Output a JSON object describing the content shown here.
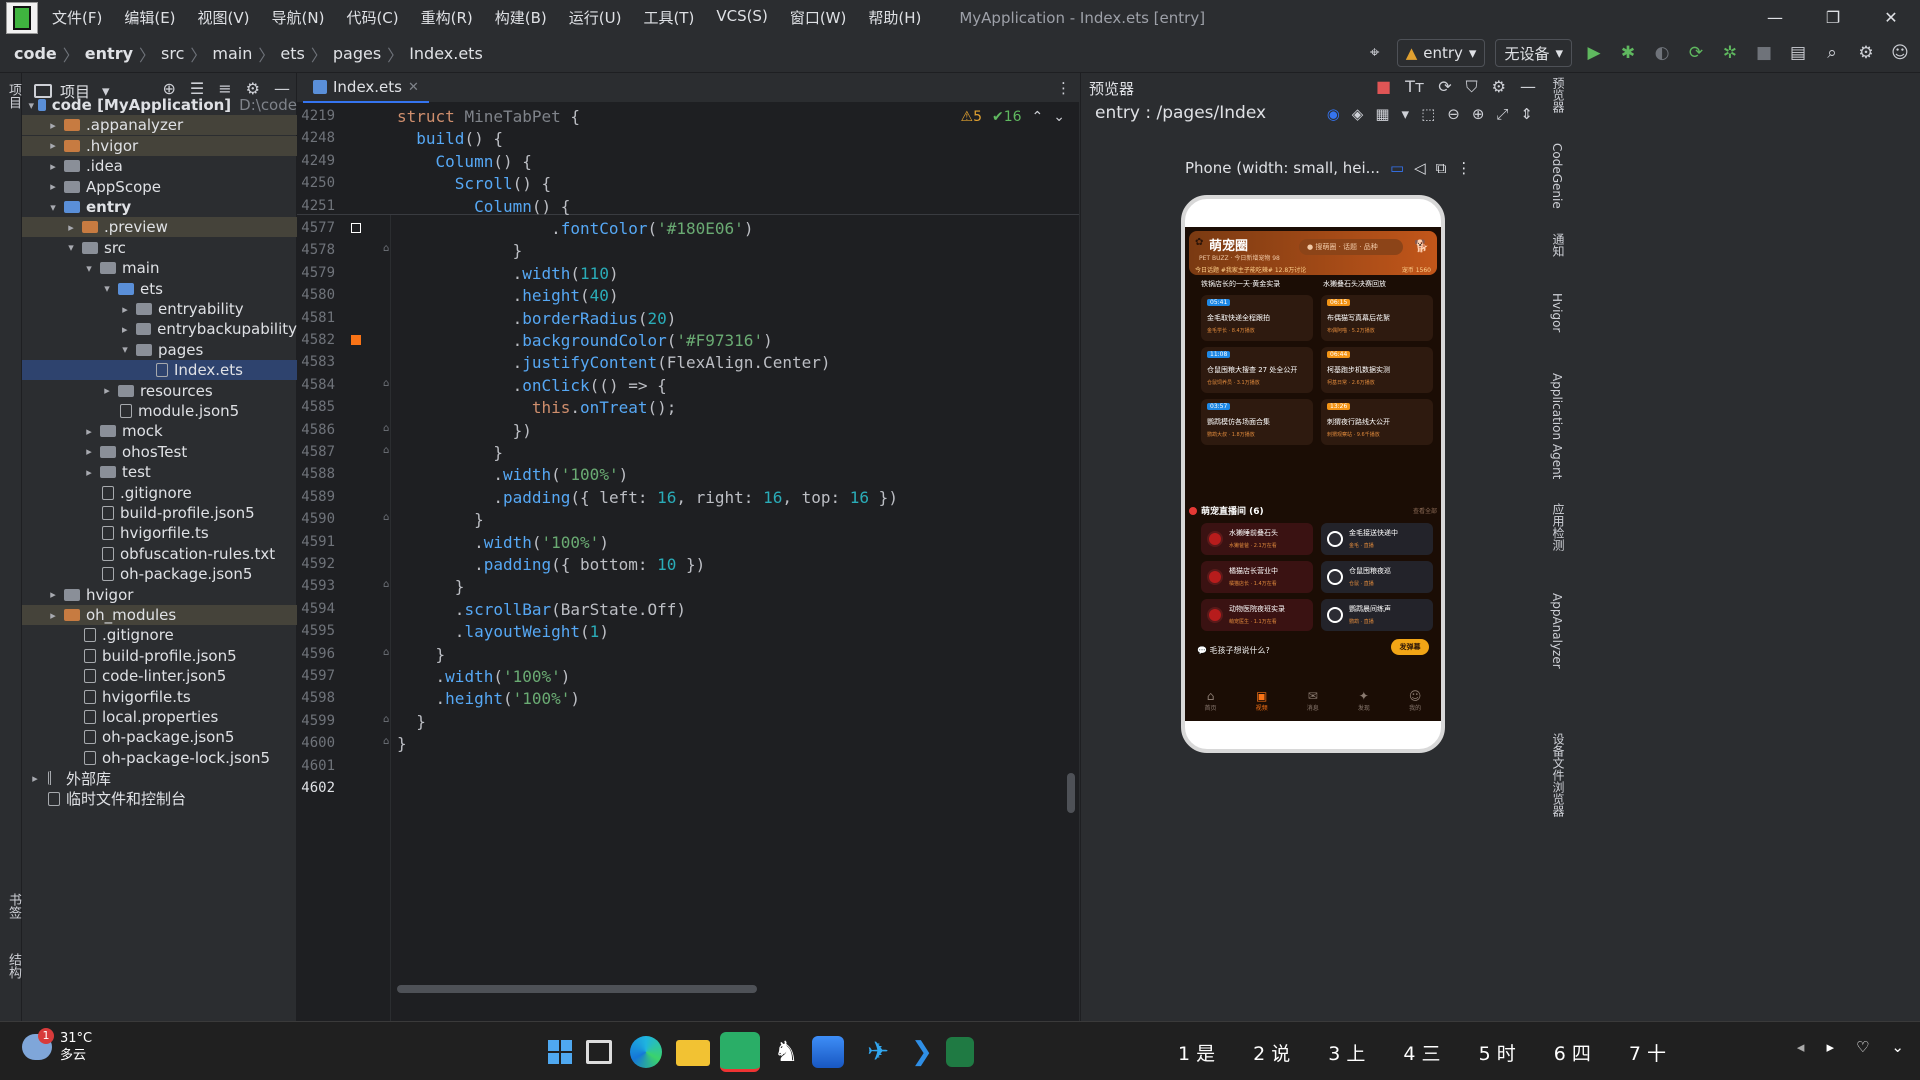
{
  "titlebar": {
    "menus": [
      "文件(F)",
      "编辑(E)",
      "视图(V)",
      "导航(N)",
      "代码(C)",
      "重构(R)",
      "构建(B)",
      "运行(U)",
      "工具(T)",
      "VCS(S)",
      "窗口(W)",
      "帮助(H)"
    ],
    "title": "MyApplication - Index.ets [entry]",
    "minimize": "—",
    "restore": "❐",
    "close": "✕"
  },
  "navbar": {
    "crumbs": [
      "code",
      "entry",
      "src",
      "main",
      "ets",
      "pages",
      "Index.ets"
    ],
    "run_config": "entry",
    "device": "无设备"
  },
  "left_strip": {
    "project": "项目",
    "bookmarks": "书签",
    "structure": "结构"
  },
  "project": {
    "title": "项目",
    "tree": [
      {
        "label": "code [MyApplication]",
        "hint": "D:\\code",
        "depth": 0,
        "arrow": "▾",
        "kind": "b",
        "bold": true
      },
      {
        "label": ".appanalyzer",
        "depth": 1,
        "arrow": "▸",
        "kind": "o",
        "hl": true
      },
      {
        "label": ".hvigor",
        "depth": 1,
        "arrow": "▸",
        "kind": "o",
        "hl": true
      },
      {
        "label": ".idea",
        "depth": 1,
        "arrow": "▸",
        "kind": "g"
      },
      {
        "label": "AppScope",
        "depth": 1,
        "arrow": "▸",
        "kind": "g"
      },
      {
        "label": "entry",
        "depth": 1,
        "arrow": "▾",
        "kind": "b",
        "bold": true
      },
      {
        "label": ".preview",
        "depth": 2,
        "arrow": "▸",
        "kind": "o",
        "hl": true
      },
      {
        "label": "src",
        "depth": 2,
        "arrow": "▾",
        "kind": "g"
      },
      {
        "label": "main",
        "depth": 3,
        "arrow": "▾",
        "kind": "g"
      },
      {
        "label": "ets",
        "depth": 4,
        "arrow": "▾",
        "kind": "b"
      },
      {
        "label": "entryability",
        "depth": 5,
        "arrow": "▸",
        "kind": "g"
      },
      {
        "label": "entrybackupability",
        "depth": 5,
        "arrow": "▸",
        "kind": "g"
      },
      {
        "label": "pages",
        "depth": 5,
        "arrow": "▾",
        "kind": "g"
      },
      {
        "label": "Index.ets",
        "depth": 6,
        "arrow": "",
        "kind": "file",
        "sel": true
      },
      {
        "label": "resources",
        "depth": 4,
        "arrow": "▸",
        "kind": "g"
      },
      {
        "label": "module.json5",
        "depth": 4,
        "arrow": "",
        "kind": "file"
      },
      {
        "label": "mock",
        "depth": 3,
        "arrow": "▸",
        "kind": "g"
      },
      {
        "label": "ohosTest",
        "depth": 3,
        "arrow": "▸",
        "kind": "g"
      },
      {
        "label": "test",
        "depth": 3,
        "arrow": "▸",
        "kind": "g"
      },
      {
        "label": ".gitignore",
        "depth": 3,
        "arrow": "",
        "kind": "file"
      },
      {
        "label": "build-profile.json5",
        "depth": 3,
        "arrow": "",
        "kind": "file"
      },
      {
        "label": "hvigorfile.ts",
        "depth": 3,
        "arrow": "",
        "kind": "file"
      },
      {
        "label": "obfuscation-rules.txt",
        "depth": 3,
        "arrow": "",
        "kind": "file"
      },
      {
        "label": "oh-package.json5",
        "depth": 3,
        "arrow": "",
        "kind": "file"
      },
      {
        "label": "hvigor",
        "depth": 1,
        "arrow": "▸",
        "kind": "g"
      },
      {
        "label": "oh_modules",
        "depth": 1,
        "arrow": "▸",
        "kind": "o",
        "hl": true
      },
      {
        "label": ".gitignore",
        "depth": 2,
        "arrow": "",
        "kind": "file"
      },
      {
        "label": "build-profile.json5",
        "depth": 2,
        "arrow": "",
        "kind": "file"
      },
      {
        "label": "code-linter.json5",
        "depth": 2,
        "arrow": "",
        "kind": "file"
      },
      {
        "label": "hvigorfile.ts",
        "depth": 2,
        "arrow": "",
        "kind": "file"
      },
      {
        "label": "local.properties",
        "depth": 2,
        "arrow": "",
        "kind": "file"
      },
      {
        "label": "oh-package.json5",
        "depth": 2,
        "arrow": "",
        "kind": "file"
      },
      {
        "label": "oh-package-lock.json5",
        "depth": 2,
        "arrow": "",
        "kind": "file"
      },
      {
        "label": "外部库",
        "depth": 0,
        "arrow": "▸",
        "kind": "lib"
      },
      {
        "label": "临时文件和控制台",
        "depth": 0,
        "arrow": "",
        "kind": "file"
      }
    ]
  },
  "editor": {
    "tab": "Index.ets",
    "warnings": "⚠5",
    "checks": "✔16",
    "sticky": [
      {
        "ln": "4219",
        "html": "<span class='kw'>struct</span> <span class='cls'>MineTabPet</span> {"
      },
      {
        "ln": "4248",
        "html": "  <span class='fn'>build</span>() {"
      },
      {
        "ln": "4249",
        "html": "    <span class='fn'>Column</span>() {"
      },
      {
        "ln": "4250",
        "html": "      <span class='fn'>Scroll</span>() {"
      },
      {
        "ln": "4251",
        "html": "        <span class='fn'>Column</span>() {"
      }
    ],
    "lines": [
      {
        "ln": "4577",
        "html": "                .<span class='fn'>fontColor</span>(<span class='str'>'#180E06'</span>)"
      },
      {
        "ln": "4578",
        "html": "            }"
      },
      {
        "ln": "4579",
        "html": "            .<span class='fn'>width</span>(<span class='num'>110</span>)"
      },
      {
        "ln": "4580",
        "html": "            .<span class='fn'>height</span>(<span class='num'>40</span>)"
      },
      {
        "ln": "4581",
        "html": "            .<span class='fn'>borderRadius</span>(<span class='num'>20</span>)"
      },
      {
        "ln": "4582",
        "html": "            .<span class='fn'>backgroundColor</span>(<span class='str'>'#F97316'</span>)"
      },
      {
        "ln": "4583",
        "html": "            .<span class='fn'>justifyContent</span>(FlexAlign.Center)"
      },
      {
        "ln": "4584",
        "html": "            .<span class='fn'>onClick</span>(() => {"
      },
      {
        "ln": "4585",
        "html": "              <span class='kw'>this</span>.<span class='fn'>onTreat</span>();"
      },
      {
        "ln": "4586",
        "html": "            })"
      },
      {
        "ln": "4587",
        "html": "          }"
      },
      {
        "ln": "4588",
        "html": "          .<span class='fn'>width</span>(<span class='str'>'100%'</span>)"
      },
      {
        "ln": "4589",
        "html": "          .<span class='fn'>padding</span>({ left: <span class='num'>16</span>, right: <span class='num'>16</span>, top: <span class='num'>16</span> })"
      },
      {
        "ln": "4590",
        "html": "        }"
      },
      {
        "ln": "4591",
        "html": "        .<span class='fn'>width</span>(<span class='str'>'100%'</span>)"
      },
      {
        "ln": "4592",
        "html": "        .<span class='fn'>padding</span>({ bottom: <span class='num'>10</span> })"
      },
      {
        "ln": "4593",
        "html": "      }"
      },
      {
        "ln": "4594",
        "html": "      .<span class='fn'>scrollBar</span>(BarState.Off)"
      },
      {
        "ln": "4595",
        "html": "      .<span class='fn'>layoutWeight</span>(<span class='num'>1</span>)"
      },
      {
        "ln": "4596",
        "html": "    }"
      },
      {
        "ln": "4597",
        "html": "    .<span class='fn'>width</span>(<span class='str'>'100%'</span>)"
      },
      {
        "ln": "4598",
        "html": "    .<span class='fn'>height</span>(<span class='str'>'100%'</span>)"
      },
      {
        "ln": "4599",
        "html": "  }"
      },
      {
        "ln": "4600",
        "html": "}"
      },
      {
        "ln": "4601",
        "html": ""
      },
      {
        "ln": "4602",
        "html": ""
      }
    ]
  },
  "preview": {
    "title": "预览器",
    "route": "entry : /pages/Index",
    "device_label": "Phone (width: small, hei...",
    "app": {
      "name": "萌宠圈",
      "sub": "PET BUZZ · 今日新增宠物 98",
      "search": "搜萌圈 · 话题 · 品种",
      "ticker": "今日话题 #我家主子能吃辣# 12.8万讨论",
      "ticker_right": "宠币 1560",
      "top_items": [
        "铁锅店长的一天·黄金实录",
        "水獭叠石头决赛回放"
      ],
      "cards": [
        {
          "tag": "05:41",
          "title": "金毛取快递全程跟拍",
          "meta": "金毛学长 · 8.4万播放"
        },
        {
          "tag": "06:15",
          "title": "布偶猫写真幕后花絮",
          "meta": "布偶阿喵 · 5.2万播放"
        },
        {
          "tag": "11:08",
          "title": "仓鼠囤粮大搜查 27 处全公开",
          "meta": "仓鼠饲养员 · 3.1万播放"
        },
        {
          "tag": "06:44",
          "title": "柯基跑步机数据实测",
          "meta": "柯基日常 · 2.6万播放"
        },
        {
          "tag": "03:57",
          "title": "鹦鹉模仿各场面合集",
          "meta": "鹦鹉大叔 · 1.8万播放"
        },
        {
          "tag": "13:26",
          "title": "刺猬夜行路线大公开",
          "meta": "刺猬观察站 · 9.6千播放"
        }
      ],
      "live_title": "萌宠直播间 (6)",
      "live_more": "查看全部",
      "lives": [
        {
          "title": "水獭睡前叠石头",
          "meta": "水獭爸爸 · 2.1万在看"
        },
        {
          "title": "金毛接送快递中",
          "meta": "金毛 · 直播"
        },
        {
          "title": "橘猫店长营业中",
          "meta": "橘猫店长 · 1.4万在看"
        },
        {
          "title": "仓鼠囤粮夜巡",
          "meta": "仓鼠 · 直播"
        },
        {
          "title": "动物医院夜班实录",
          "meta": "萌宠医生 · 1.1万在看"
        },
        {
          "title": "鹦鹉晨间练声",
          "meta": "鹦鹉 · 直播"
        }
      ],
      "ask": "💬 毛孩子想说什么?",
      "post": "发弹幕",
      "tabs": [
        "首页",
        "视频",
        "消息",
        "发现",
        "我的"
      ]
    }
  },
  "right_strip": [
    "预览器",
    "CodeGenie",
    "通知",
    "Hvigor",
    "Application Agent",
    "应用检测",
    "AppAnalyzer",
    "设备文件浏览器"
  ],
  "taskbar": {
    "badge": "1",
    "temp": "31°C",
    "weather": "多云",
    "ime": [
      "1 是",
      "2 说",
      "3 上",
      "4 三",
      "5 时",
      "6 四",
      "7 十"
    ]
  }
}
